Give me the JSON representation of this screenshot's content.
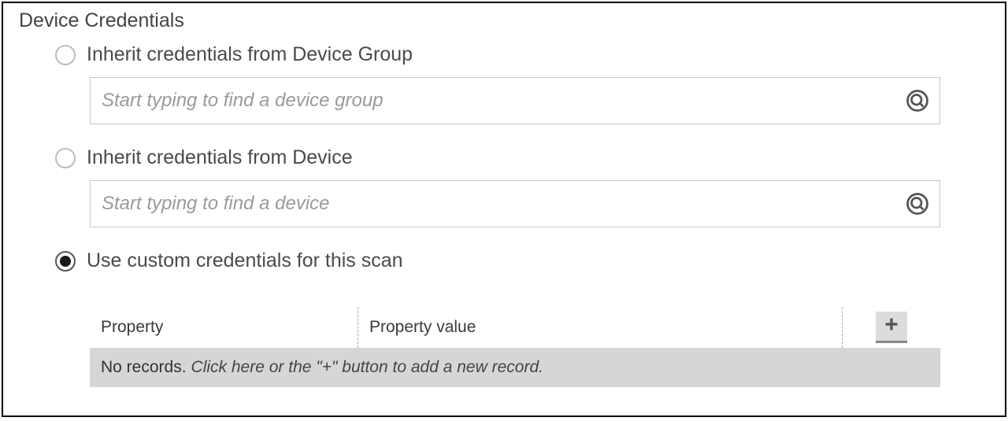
{
  "section": {
    "title": "Device Credentials"
  },
  "options": {
    "inheritGroup": {
      "label": "Inherit credentials from Device Group",
      "selected": false,
      "search": {
        "placeholder": "Start typing to find a device group",
        "value": ""
      }
    },
    "inheritDevice": {
      "label": "Inherit credentials from Device",
      "selected": false,
      "search": {
        "placeholder": "Start typing to find a device",
        "value": ""
      }
    },
    "custom": {
      "label": "Use custom credentials for this scan",
      "selected": true
    }
  },
  "table": {
    "columns": {
      "property": "Property",
      "propertyValue": "Property value"
    },
    "rows": [],
    "empty": {
      "prefix": "No records.",
      "hint": "Click here or the \"+\" button to add a new record."
    }
  }
}
